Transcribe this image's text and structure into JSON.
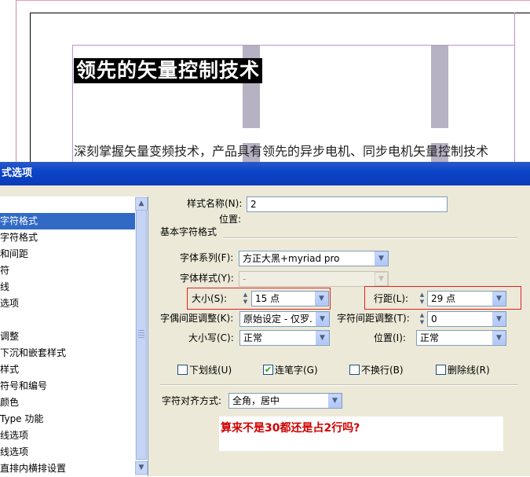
{
  "document": {
    "title": "领先的矢量控制技术",
    "body": "深刻掌握矢量变频技术，产品具有领先的异步电机、同步电机矢量控制技术"
  },
  "dialog": {
    "title": "式选项",
    "style_name_label": "样式名称(N):",
    "style_name_value": "2",
    "location_label": "位置:",
    "section_title": "基本字符格式",
    "font_family_label": "字体系列(F):",
    "font_family_value": "方正大黑+myriad pro",
    "font_style_label": "字体样式(Y):",
    "font_style_value": "-",
    "size_label": "大小(S):",
    "size_value": "15 点",
    "leading_label": "行距(L):",
    "leading_value": "29 点",
    "kerning_label": "字偶间距调整(K):",
    "kerning_value": "原始设定 - 仅罗.",
    "tracking_label": "字符间距调整(T):",
    "tracking_value": "0",
    "case_label": "大小写(C):",
    "case_value": "正常",
    "position_label": "位置(I):",
    "position_value": "正常",
    "underline_label": "下划线(U)",
    "ligature_label": "连笔字(G)",
    "nobreak_label": "不换行(B)",
    "strike_label": "删除线(R)",
    "align_label": "字符对齐方式:",
    "align_value": "全角，居中"
  },
  "sidebar": {
    "items": [
      {
        "label": "字符格式",
        "selected": true
      },
      {
        "label": "字符格式",
        "selected": false
      },
      {
        "label": "和间距",
        "selected": false
      },
      {
        "label": "符",
        "selected": false
      },
      {
        "label": "线",
        "selected": false
      },
      {
        "label": "选项",
        "selected": false
      },
      {
        "label": "",
        "selected": false
      },
      {
        "label": "调整",
        "selected": false
      },
      {
        "label": "下沉和嵌套样式",
        "selected": false
      },
      {
        "label": " 样式",
        "selected": false
      },
      {
        "label": "符号和编号",
        "selected": false
      },
      {
        "label": "颜色",
        "selected": false
      },
      {
        "label": "Type 功能",
        "selected": false
      },
      {
        "label": "线选项",
        "selected": false
      },
      {
        "label": "线选项",
        "selected": false
      },
      {
        "label": "直排内横排设置",
        "selected": false
      }
    ]
  },
  "annotation": {
    "text": "算来不是30都还是占2行吗?"
  },
  "icons": {
    "combo": "chevron-down-icon",
    "spin": "spinner-arrows-icon",
    "check": "checkmark-icon"
  },
  "colors": {
    "titlebar": "#0b44c8",
    "selection": "#316ac5",
    "highlight_box": "#e02020",
    "annotation": "#d00000"
  }
}
